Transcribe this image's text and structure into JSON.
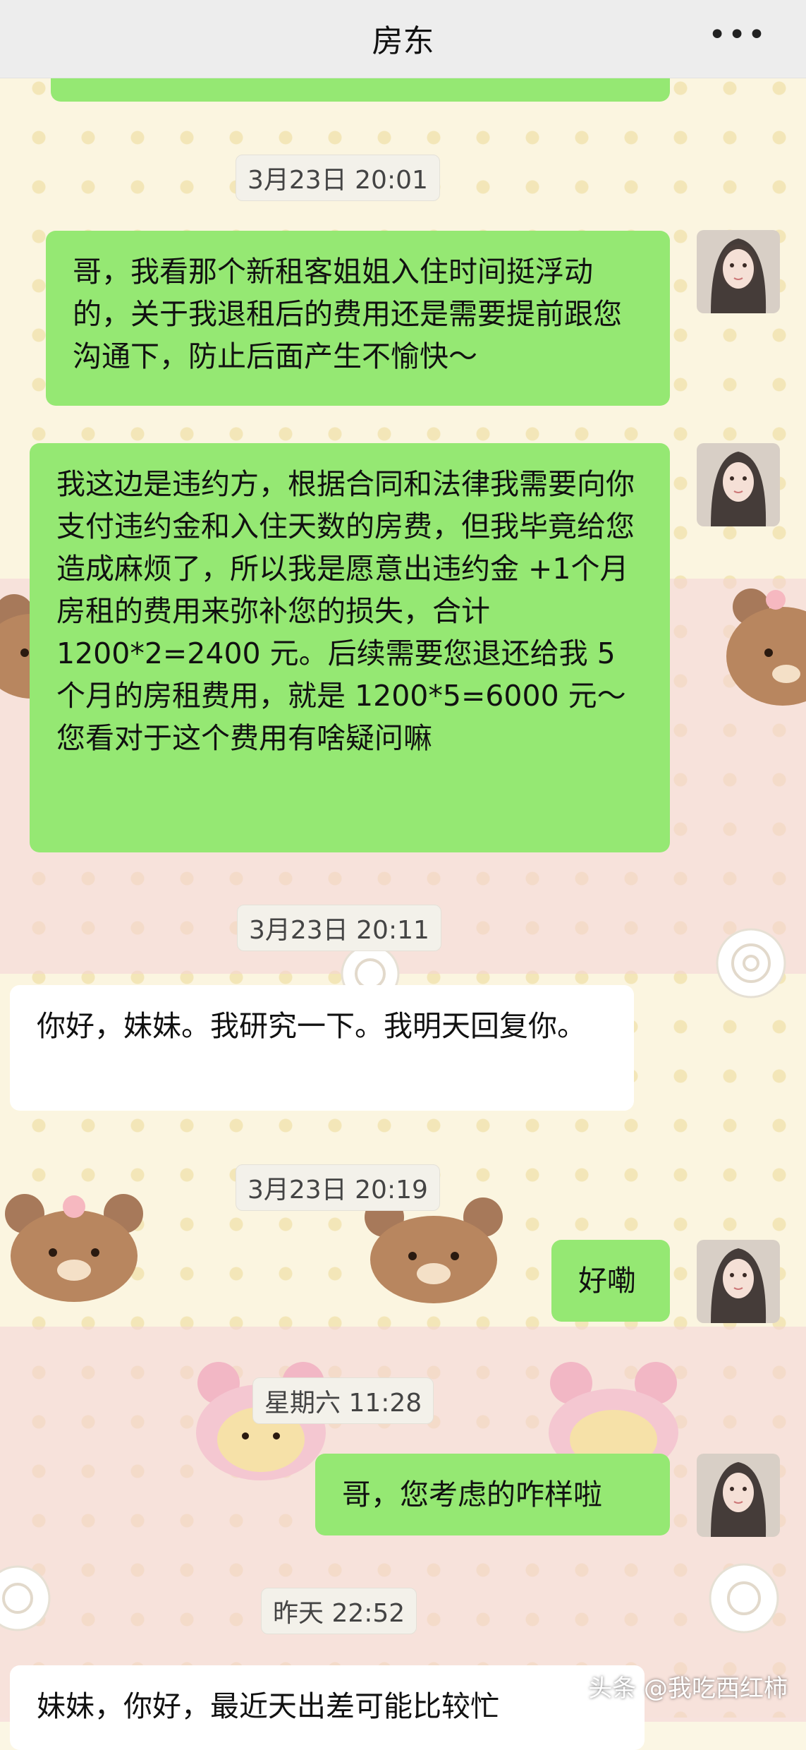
{
  "header": {
    "title": "房东",
    "more_label": "•••"
  },
  "messages": [
    {
      "id": "ts1",
      "type": "timestamp",
      "text": "3月23日 20:01"
    },
    {
      "id": "m1",
      "type": "sent",
      "text": "哥，我看那个新租客姐姐入住时间挺浮动的，关于我退租后的费用还是需要提前跟您沟通下，防止后面产生不愉快～"
    },
    {
      "id": "m2",
      "type": "sent",
      "text": "我这边是违约方，根据合同和法律我需要向你支付违约金和入住天数的房费，但我毕竟给您造成麻烦了，所以我是愿意出违约金 +1个月房租的费用来弥补您的损失，合计 1200*2=2400 元。后续需要您退还给我 5 个月的房租费用，就是 1200*5=6000 元～您看对于这个费用有啥疑问嘛"
    },
    {
      "id": "ts2",
      "type": "timestamp",
      "text": "3月23日 20:11"
    },
    {
      "id": "m3",
      "type": "received",
      "text": "你好，妹妹。我研究一下。我明天回复你。"
    },
    {
      "id": "ts3",
      "type": "timestamp",
      "text": "3月23日 20:19"
    },
    {
      "id": "m4",
      "type": "sent",
      "text": "好嘞"
    },
    {
      "id": "ts4",
      "type": "timestamp",
      "text": "星期六 11:28"
    },
    {
      "id": "m5",
      "type": "sent",
      "text": "哥，您考虑的咋样啦"
    },
    {
      "id": "ts5",
      "type": "timestamp",
      "text": "昨天 22:52"
    },
    {
      "id": "m6",
      "type": "received",
      "text": "妹妹，你好，最近天出差可能比较忙"
    }
  ],
  "watermark": "头条 @我吃西红柿",
  "colors": {
    "sent_bubble": "#95e873",
    "received_bubble": "#ffffff",
    "header_bg": "#ededed"
  },
  "icons": [
    "more-icon",
    "avatar-image",
    "bear-sticker-decor"
  ]
}
